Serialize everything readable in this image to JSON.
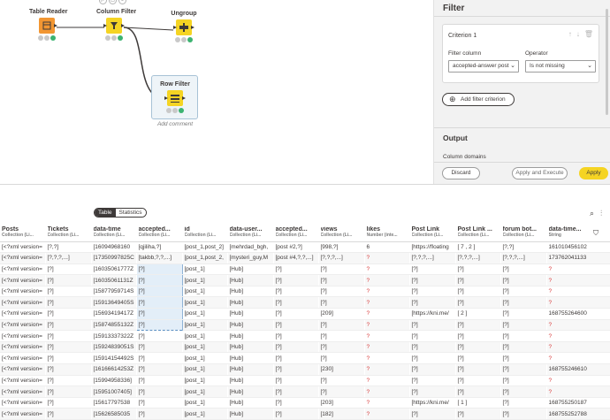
{
  "workflow": {
    "nodes": [
      {
        "id": "table-reader",
        "label": "Table Reader"
      },
      {
        "id": "column-filter",
        "label": "Column Filter"
      },
      {
        "id": "ungroup",
        "label": "Ungroup"
      },
      {
        "id": "row-filter",
        "label": "Row Filter"
      }
    ],
    "add_comment": "Add comment",
    "colors": {
      "orange": "#f29632",
      "yellow": "#f5d423",
      "ok": "#3cb371"
    }
  },
  "panel": {
    "title": "Filter",
    "criterion": {
      "title": "Criterion 1",
      "filter_column_label": "Filter column",
      "filter_column_value": "accepted-answer post",
      "operator_label": "Operator",
      "operator_value": "Is not missing"
    },
    "add_criterion": "Add filter criterion",
    "output_title": "Output",
    "column_domains": "Column domains",
    "buttons": {
      "discard": "Discard",
      "apply_execute": "Apply and Execute",
      "apply": "Apply"
    }
  },
  "table": {
    "tabs": {
      "table": "Table",
      "statistics": "Statistics"
    },
    "columns": [
      {
        "name": "Posts",
        "type": "Collection (Li..."
      },
      {
        "name": "Tickets",
        "type": "Collection (Li..."
      },
      {
        "name": "data-time",
        "type": "Collection (Li..."
      },
      {
        "name": "accepted...",
        "type": "Collection (Li..."
      },
      {
        "name": "id",
        "type": "Collection (Li..."
      },
      {
        "name": "data-user...",
        "type": "Collection (Li..."
      },
      {
        "name": "accepted...",
        "type": "Collection (Li..."
      },
      {
        "name": "views",
        "type": "Collection (Li..."
      },
      {
        "name": "likes",
        "type": "Number (inte..."
      },
      {
        "name": "Post Link",
        "type": "Collection (Li..."
      },
      {
        "name": "Post Link ...",
        "type": "Collection (Li..."
      },
      {
        "name": "forum bot...",
        "type": "Collection (Li..."
      },
      {
        "name": "data-time...",
        "type": "String"
      }
    ],
    "rows": [
      [
        "[<?xml version=",
        "[?,?]",
        "[16094968160",
        "[qjiliha,?]",
        "[post_1,post_2]",
        "[mehrdad_bgh,",
        "[post #2,?]",
        "[998,?]",
        "6",
        "[https://floating",
        "[ 7 , 2 ]",
        "[?,?]",
        "161010456102"
      ],
      [
        "[<?xml version=",
        "[?,?,?,...]",
        "[17350997825C",
        "[takbb,?,?,...]",
        "[post_1,post_2,",
        "[mysteri_guy,M",
        "[post #4,?,?,...]",
        "[?,?,?,...]",
        "?",
        "[?,?,?,...]",
        "[?,?,?,...]",
        "[?,?,?,...]",
        "173762041133"
      ],
      [
        "[<?xml version=",
        "[?]",
        "[16035061777Z",
        "[?]",
        "[post_1]",
        "[Hub]",
        "[?]",
        "[?]",
        "?",
        "[?]",
        "[?]",
        "[?]",
        "?"
      ],
      [
        "[<?xml version=",
        "[?]",
        "[16035061131Z",
        "[?]",
        "[post_1]",
        "[Hub]",
        "[?]",
        "[?]",
        "?",
        "[?]",
        "[?]",
        "[?]",
        "?"
      ],
      [
        "[<?xml version=",
        "[?]",
        "[15877959714S",
        "[?]",
        "[post_1]",
        "[Hub]",
        "[?]",
        "[?]",
        "?",
        "[?]",
        "[?]",
        "[?]",
        "?"
      ],
      [
        "[<?xml version=",
        "[?]",
        "[15913649405S",
        "[?]",
        "[post_1]",
        "[Hub]",
        "[?]",
        "[?]",
        "?",
        "[?]",
        "[?]",
        "[?]",
        "?"
      ],
      [
        "[<?xml version=",
        "[?]",
        "[15693419417Z",
        "[?]",
        "[post_1]",
        "[Hub]",
        "[?]",
        "[209]",
        "?",
        "[https://kni.me/",
        "[ 2 ]",
        "[?]",
        "168755264600"
      ],
      [
        "[<?xml version=",
        "[?]",
        "[15874855132Z",
        "[?]",
        "[post_1]",
        "[Hub]",
        "[?]",
        "[?]",
        "?",
        "[?]",
        "[?]",
        "[?]",
        "?"
      ],
      [
        "[<?xml version=",
        "[?]",
        "[15913337322Z",
        "[?]",
        "[post_1]",
        "[Hub]",
        "[?]",
        "[?]",
        "?",
        "[?]",
        "[?]",
        "[?]",
        "?"
      ],
      [
        "[<?xml version=",
        "[?]",
        "[15924839051S",
        "[?]",
        "[post_1]",
        "[Hub]",
        "[?]",
        "[?]",
        "?",
        "[?]",
        "[?]",
        "[?]",
        "?"
      ],
      [
        "[<?xml version=",
        "[?]",
        "[15914154492S",
        "[?]",
        "[post_1]",
        "[Hub]",
        "[?]",
        "[?]",
        "?",
        "[?]",
        "[?]",
        "[?]",
        "?"
      ],
      [
        "[<?xml version=",
        "[?]",
        "[16166614253Z",
        "[?]",
        "[post_1]",
        "[Hub]",
        "[?]",
        "[230]",
        "?",
        "[?]",
        "[?]",
        "[?]",
        "168755246610"
      ],
      [
        "[<?xml version=",
        "[?]",
        "[15994958336]",
        "[?]",
        "[post_1]",
        "[Hub]",
        "[?]",
        "[?]",
        "?",
        "[?]",
        "[?]",
        "[?]",
        "?"
      ],
      [
        "[<?xml version=",
        "[?]",
        "[15951007405]",
        "[?]",
        "[post_1]",
        "[Hub]",
        "[?]",
        "[?]",
        "?",
        "[?]",
        "[?]",
        "[?]",
        "?"
      ],
      [
        "[<?xml version=",
        "[?]",
        "[15617797538",
        "[?]",
        "[post_1]",
        "[Hub]",
        "[?]",
        "[203]",
        "?",
        "[https://kni.me/",
        "[ 1 ]",
        "[?]",
        "168755250187"
      ],
      [
        "[<?xml version=",
        "[?]",
        "[15626585035",
        "[?]",
        "[post_1]",
        "[Hub]",
        "[?]",
        "[182]",
        "?",
        "[?]",
        "[?]",
        "[?]",
        "168755252788"
      ]
    ]
  }
}
